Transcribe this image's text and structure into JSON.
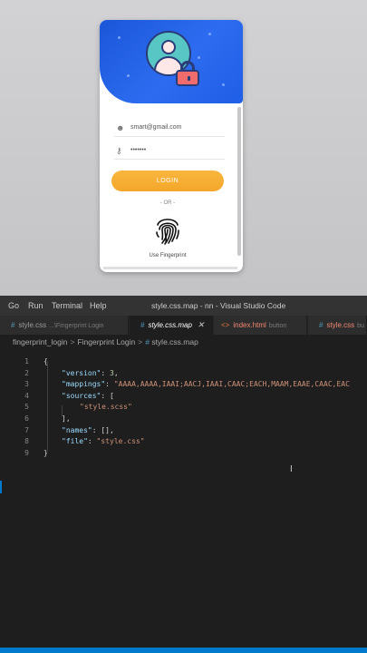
{
  "preview": {
    "email": "smart@gmail.com",
    "password": "•••••••",
    "login_label": "LOGIN",
    "or_label": "- OR -",
    "fingerprint_label": "Use Fingerprint"
  },
  "vscode": {
    "menu": [
      "Go",
      "Run",
      "Terminal",
      "Help"
    ],
    "window_title": "style.css.map - nn - Visual Studio Code",
    "tabs": [
      {
        "name": "style.css",
        "sub": "...\\Fingerprint Login"
      },
      {
        "name": "style.css.map",
        "sub": ""
      },
      {
        "name": "index.html",
        "sub": "button"
      },
      {
        "name": "style.css",
        "sub": "bu"
      }
    ],
    "breadcrumb": [
      "fingerprint_login",
      "Fingerprint Login",
      "style.css.map"
    ],
    "code_lines": [
      {
        "num": "1"
      },
      {
        "num": "2"
      },
      {
        "num": "3"
      },
      {
        "num": "4"
      },
      {
        "num": "5"
      },
      {
        "num": "6"
      },
      {
        "num": "7"
      },
      {
        "num": "8"
      },
      {
        "num": "9"
      }
    ],
    "json_content": {
      "version_key": "\"version\"",
      "version_val": "3",
      "mappings_key": "\"mappings\"",
      "mappings_val": "\"AAAA,AAAA,IAAI;AACJ,IAAI,CAAC;EACH,MAAM,EAAE,CAAC,EAC",
      "sources_key": "\"sources\"",
      "sources_val": "\"style.scss\"",
      "names_key": "\"names\"",
      "names_val": "[]",
      "file_key": "\"file\"",
      "file_val": "\"style.css\""
    }
  }
}
